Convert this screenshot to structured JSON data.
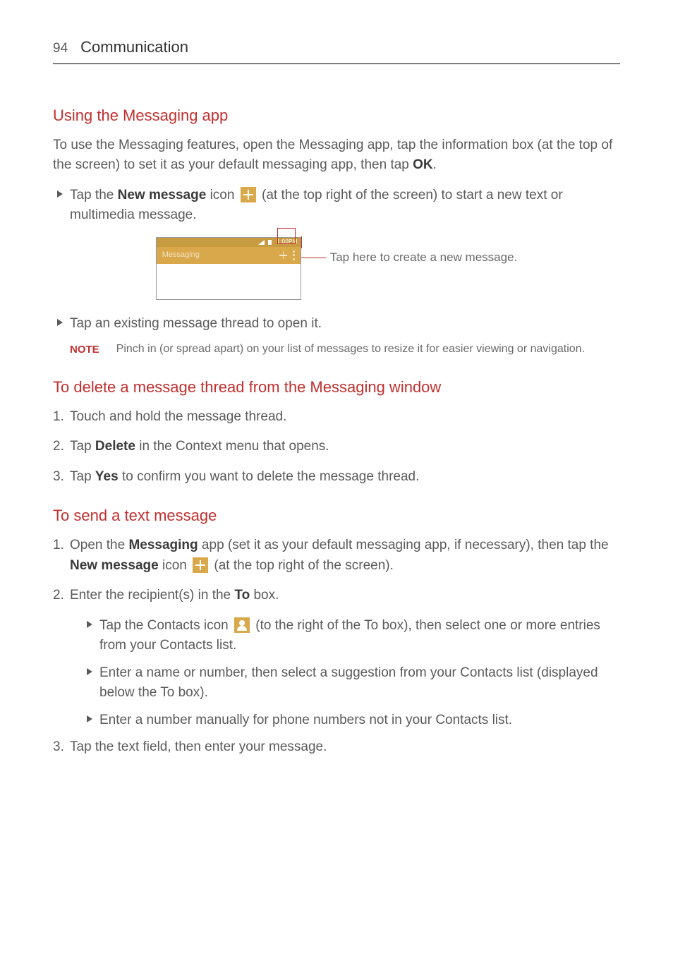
{
  "header": {
    "pageNumber": "94",
    "chapter": "Communication"
  },
  "section1": {
    "title": "Using the Messaging app",
    "intro_a": "To use the Messaging features, open the Messaging app,  tap the information box (at the top of the screen) to set it as your default messaging app, then tap ",
    "intro_b": "OK",
    "intro_c": ".",
    "bullet1_a": "Tap the ",
    "bullet1_b": "New message",
    "bullet1_c": " icon ",
    "bullet1_d": " (at the top right of the screen) to start a new text or multimedia message.",
    "screenshot": {
      "time": "1:00PM",
      "appTitle": "Messaging",
      "callout": "Tap here to create a new message."
    },
    "bullet2": "Tap an existing message thread to open it.",
    "noteLabel": "NOTE",
    "noteText": "Pinch in (or spread apart) on your list of messages to resize it for easier viewing or navigation."
  },
  "section2": {
    "title": "To delete a message thread from the Messaging window",
    "s1_num": "1.",
    "s1_text": " Touch and hold the message thread.",
    "s2_num": "2.",
    "s2_a": " Tap ",
    "s2_b": "Delete",
    "s2_c": " in the Context menu that opens.",
    "s3_num": "3.",
    "s3_a": " Tap ",
    "s3_b": "Yes",
    "s3_c": " to confirm you want to delete the message thread."
  },
  "section3": {
    "title": "To send a text message",
    "s1_num": "1.",
    "s1_a": " Open the ",
    "s1_b": "Messaging",
    "s1_c": " app (set it as your default messaging app, if necessary), then tap the ",
    "s1_d": "New message",
    "s1_e": " icon ",
    "s1_f": " (at the top right of the screen).",
    "s2_num": "2.",
    "s2_a": " Enter the recipient(s) in the ",
    "s2_b": "To",
    "s2_c": " box.",
    "sub1_a": "Tap the Contacts icon ",
    "sub1_b": " (to the right of the To box), then select one or more entries from your Contacts list.",
    "sub2": "Enter a name or number, then select a suggestion from your Contacts list (displayed below the To box).",
    "sub3": "Enter a number manually for phone numbers not in your Contacts list.",
    "s3_num": "3.",
    "s3_text": " Tap the text field, then enter your message."
  }
}
